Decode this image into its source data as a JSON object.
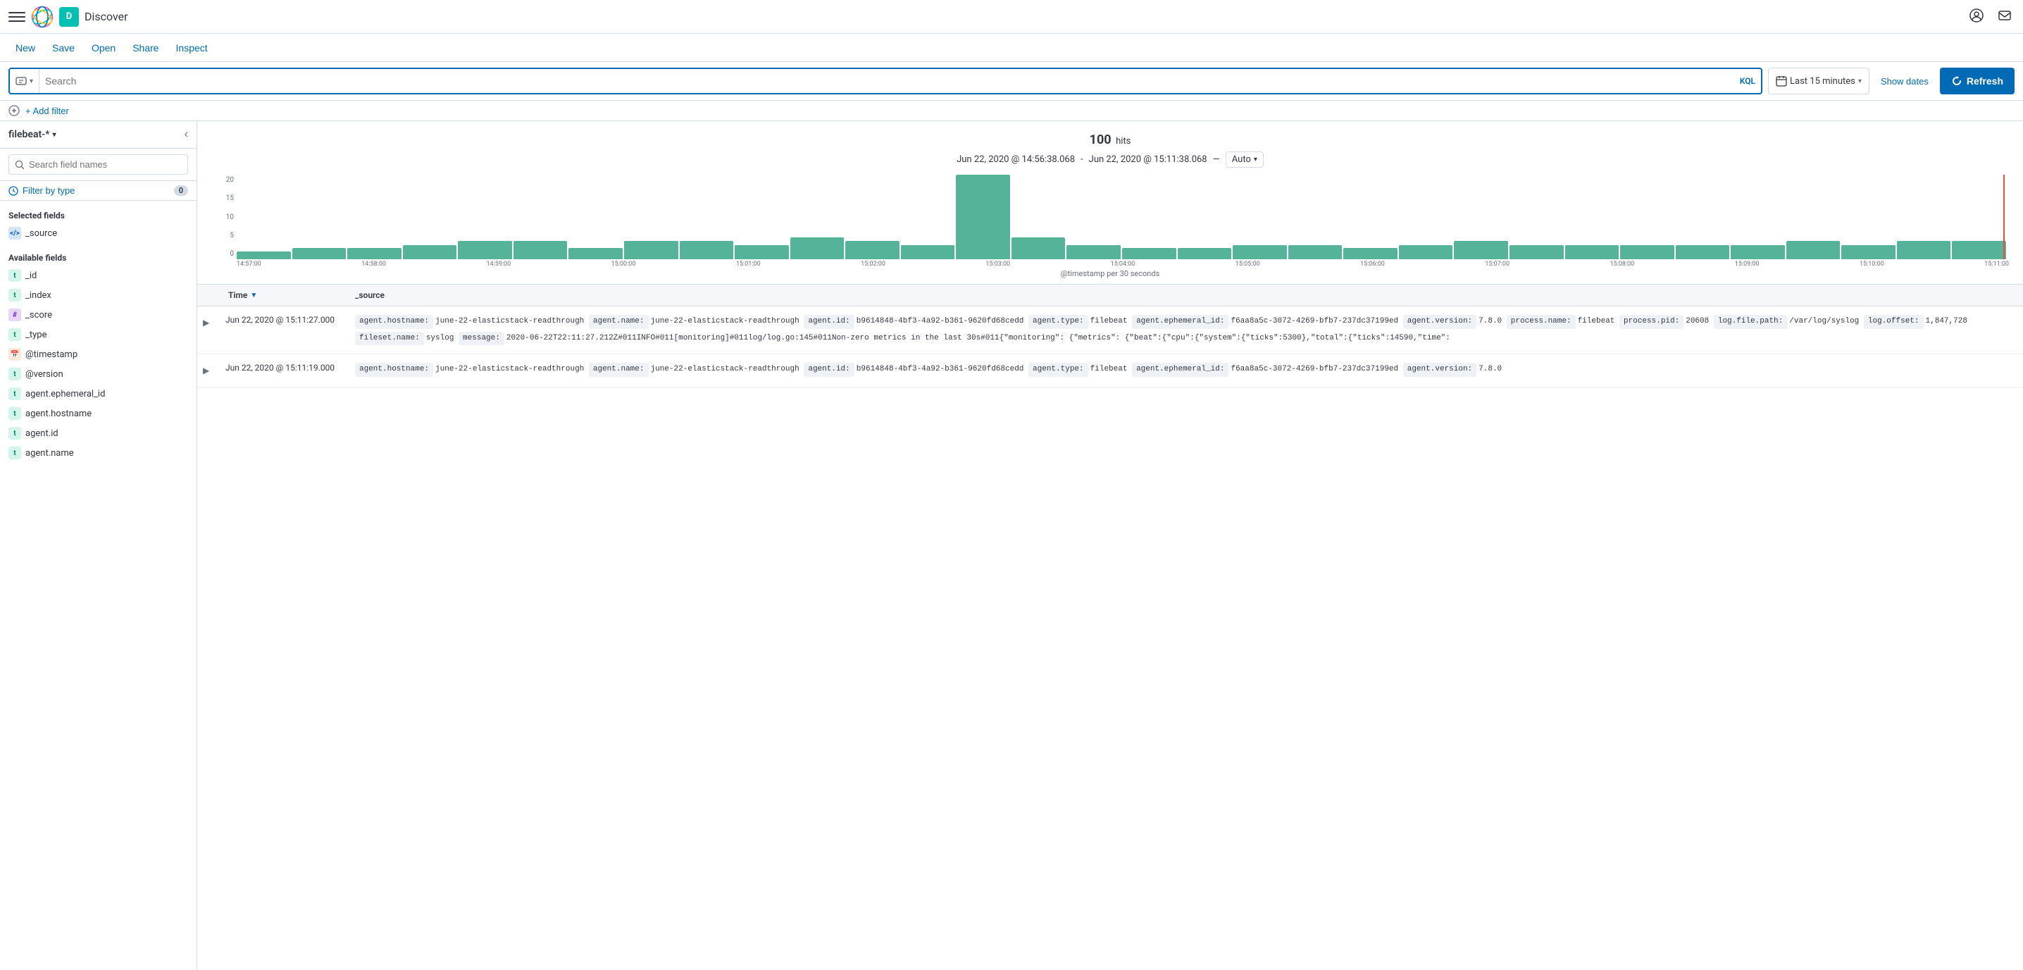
{
  "app": {
    "title": "Discover",
    "avatar_letter": "D"
  },
  "nav": {
    "menu_items": [
      "New",
      "Save",
      "Open",
      "Share",
      "Inspect"
    ]
  },
  "search": {
    "placeholder": "Search",
    "kql_label": "KQL",
    "time_range": "Last 15 minutes",
    "show_dates": "Show dates",
    "refresh_label": "Refresh"
  },
  "filter_row": {
    "add_filter": "+ Add filter"
  },
  "sidebar": {
    "index_pattern": "filebeat-*",
    "search_placeholder": "Search field names",
    "filter_type_label": "Filter by type",
    "filter_type_count": "0",
    "selected_fields_title": "Selected fields",
    "selected_fields": [
      {
        "name": "_source",
        "type": "code"
      }
    ],
    "available_fields_title": "Available fields",
    "available_fields": [
      {
        "name": "_id",
        "type": "t"
      },
      {
        "name": "_index",
        "type": "t"
      },
      {
        "name": "_score",
        "type": "hash"
      },
      {
        "name": "_type",
        "type": "t"
      },
      {
        "name": "@timestamp",
        "type": "calendar"
      },
      {
        "name": "@version",
        "type": "t"
      },
      {
        "name": "agent.ephemeral_id",
        "type": "t"
      },
      {
        "name": "agent.hostname",
        "type": "t"
      },
      {
        "name": "agent.id",
        "type": "t"
      },
      {
        "name": "agent.name",
        "type": "t"
      }
    ]
  },
  "chart": {
    "hits_count": "100",
    "hits_label": "hits",
    "time_start": "Jun 22, 2020 @ 14:56:38.068",
    "time_end": "Jun 22, 2020 @ 15:11:38.068",
    "interval_label": "Auto",
    "x_axis_label": "@timestamp per 30 seconds",
    "y_labels": [
      "20",
      "15",
      "10",
      "5",
      "0"
    ],
    "x_labels": [
      "14:57:00",
      "14:58:00",
      "14:59:00",
      "15:00:00",
      "15:01:00",
      "15:02:00",
      "15:03:00",
      "15:04:00",
      "15:05:00",
      "15:06:00",
      "15:07:00",
      "15:08:00",
      "15:09:00",
      "15:10:00",
      "15:11:00"
    ],
    "bars": [
      2,
      3,
      3,
      4,
      5,
      5,
      3,
      5,
      5,
      4,
      6,
      5,
      4,
      23,
      6,
      4,
      3,
      3,
      4,
      4,
      3,
      4,
      5,
      4,
      4,
      4,
      4,
      4,
      5,
      4,
      5,
      5
    ]
  },
  "results": {
    "columns": [
      "Time",
      "_source"
    ],
    "rows": [
      {
        "time": "Jun 22, 2020 @ 15:11:27.000",
        "source_fields": [
          {
            "key": "agent.hostname:",
            "value": "june-22-elasticstack-readthrough"
          },
          {
            "key": "agent.name:",
            "value": "june-22-elasticstack-readthrough"
          },
          {
            "key": "agent.id:",
            "value": "b9614848-4bf3-4a92-b361-9620fd68cedd"
          },
          {
            "key": "agent.type:",
            "value": "filebeat"
          },
          {
            "key": "agent.ephemeral_id:",
            "value": "f6aa8a5c-3072-4269-bfb7-237dc37199ed"
          },
          {
            "key": "agent.version:",
            "value": "7.8.0"
          },
          {
            "key": "process.name:",
            "value": "filebeat"
          },
          {
            "key": "process.pid:",
            "value": "20608"
          },
          {
            "key": "log.file.path:",
            "value": "/var/log/syslog"
          },
          {
            "key": "log.offset:",
            "value": "1,847,728"
          },
          {
            "key": "fileset.name:",
            "value": "syslog"
          },
          {
            "key": "message:",
            "value": "2020-06-22T22:11:27.212Z#011INFO#011[monitoring]#011log/log.go:145#011Non-zero metrics in the last 30s#011{\"monitoring\": {\"metrics\": {\"beat\":{\"cpu\":{\"system\":{\"ticks\":5300},\"total\":{\"ticks\":14590,\"time\":"
          }
        ]
      },
      {
        "time": "Jun 22, 2020 @ 15:11:19.000",
        "source_fields": [
          {
            "key": "agent.hostname:",
            "value": "june-22-elasticstack-readthrough"
          },
          {
            "key": "agent.name:",
            "value": "june-22-elasticstack-readthrough"
          },
          {
            "key": "agent.id:",
            "value": "b9614848-4bf3-4a92-b361-9620fd68cedd"
          },
          {
            "key": "agent.type:",
            "value": "filebeat"
          },
          {
            "key": "agent.ephemeral_id:",
            "value": "f6aa8a5c-3072-4269-bfb7-237dc37199ed"
          },
          {
            "key": "agent.version:",
            "value": "7.8.0"
          }
        ]
      }
    ]
  }
}
